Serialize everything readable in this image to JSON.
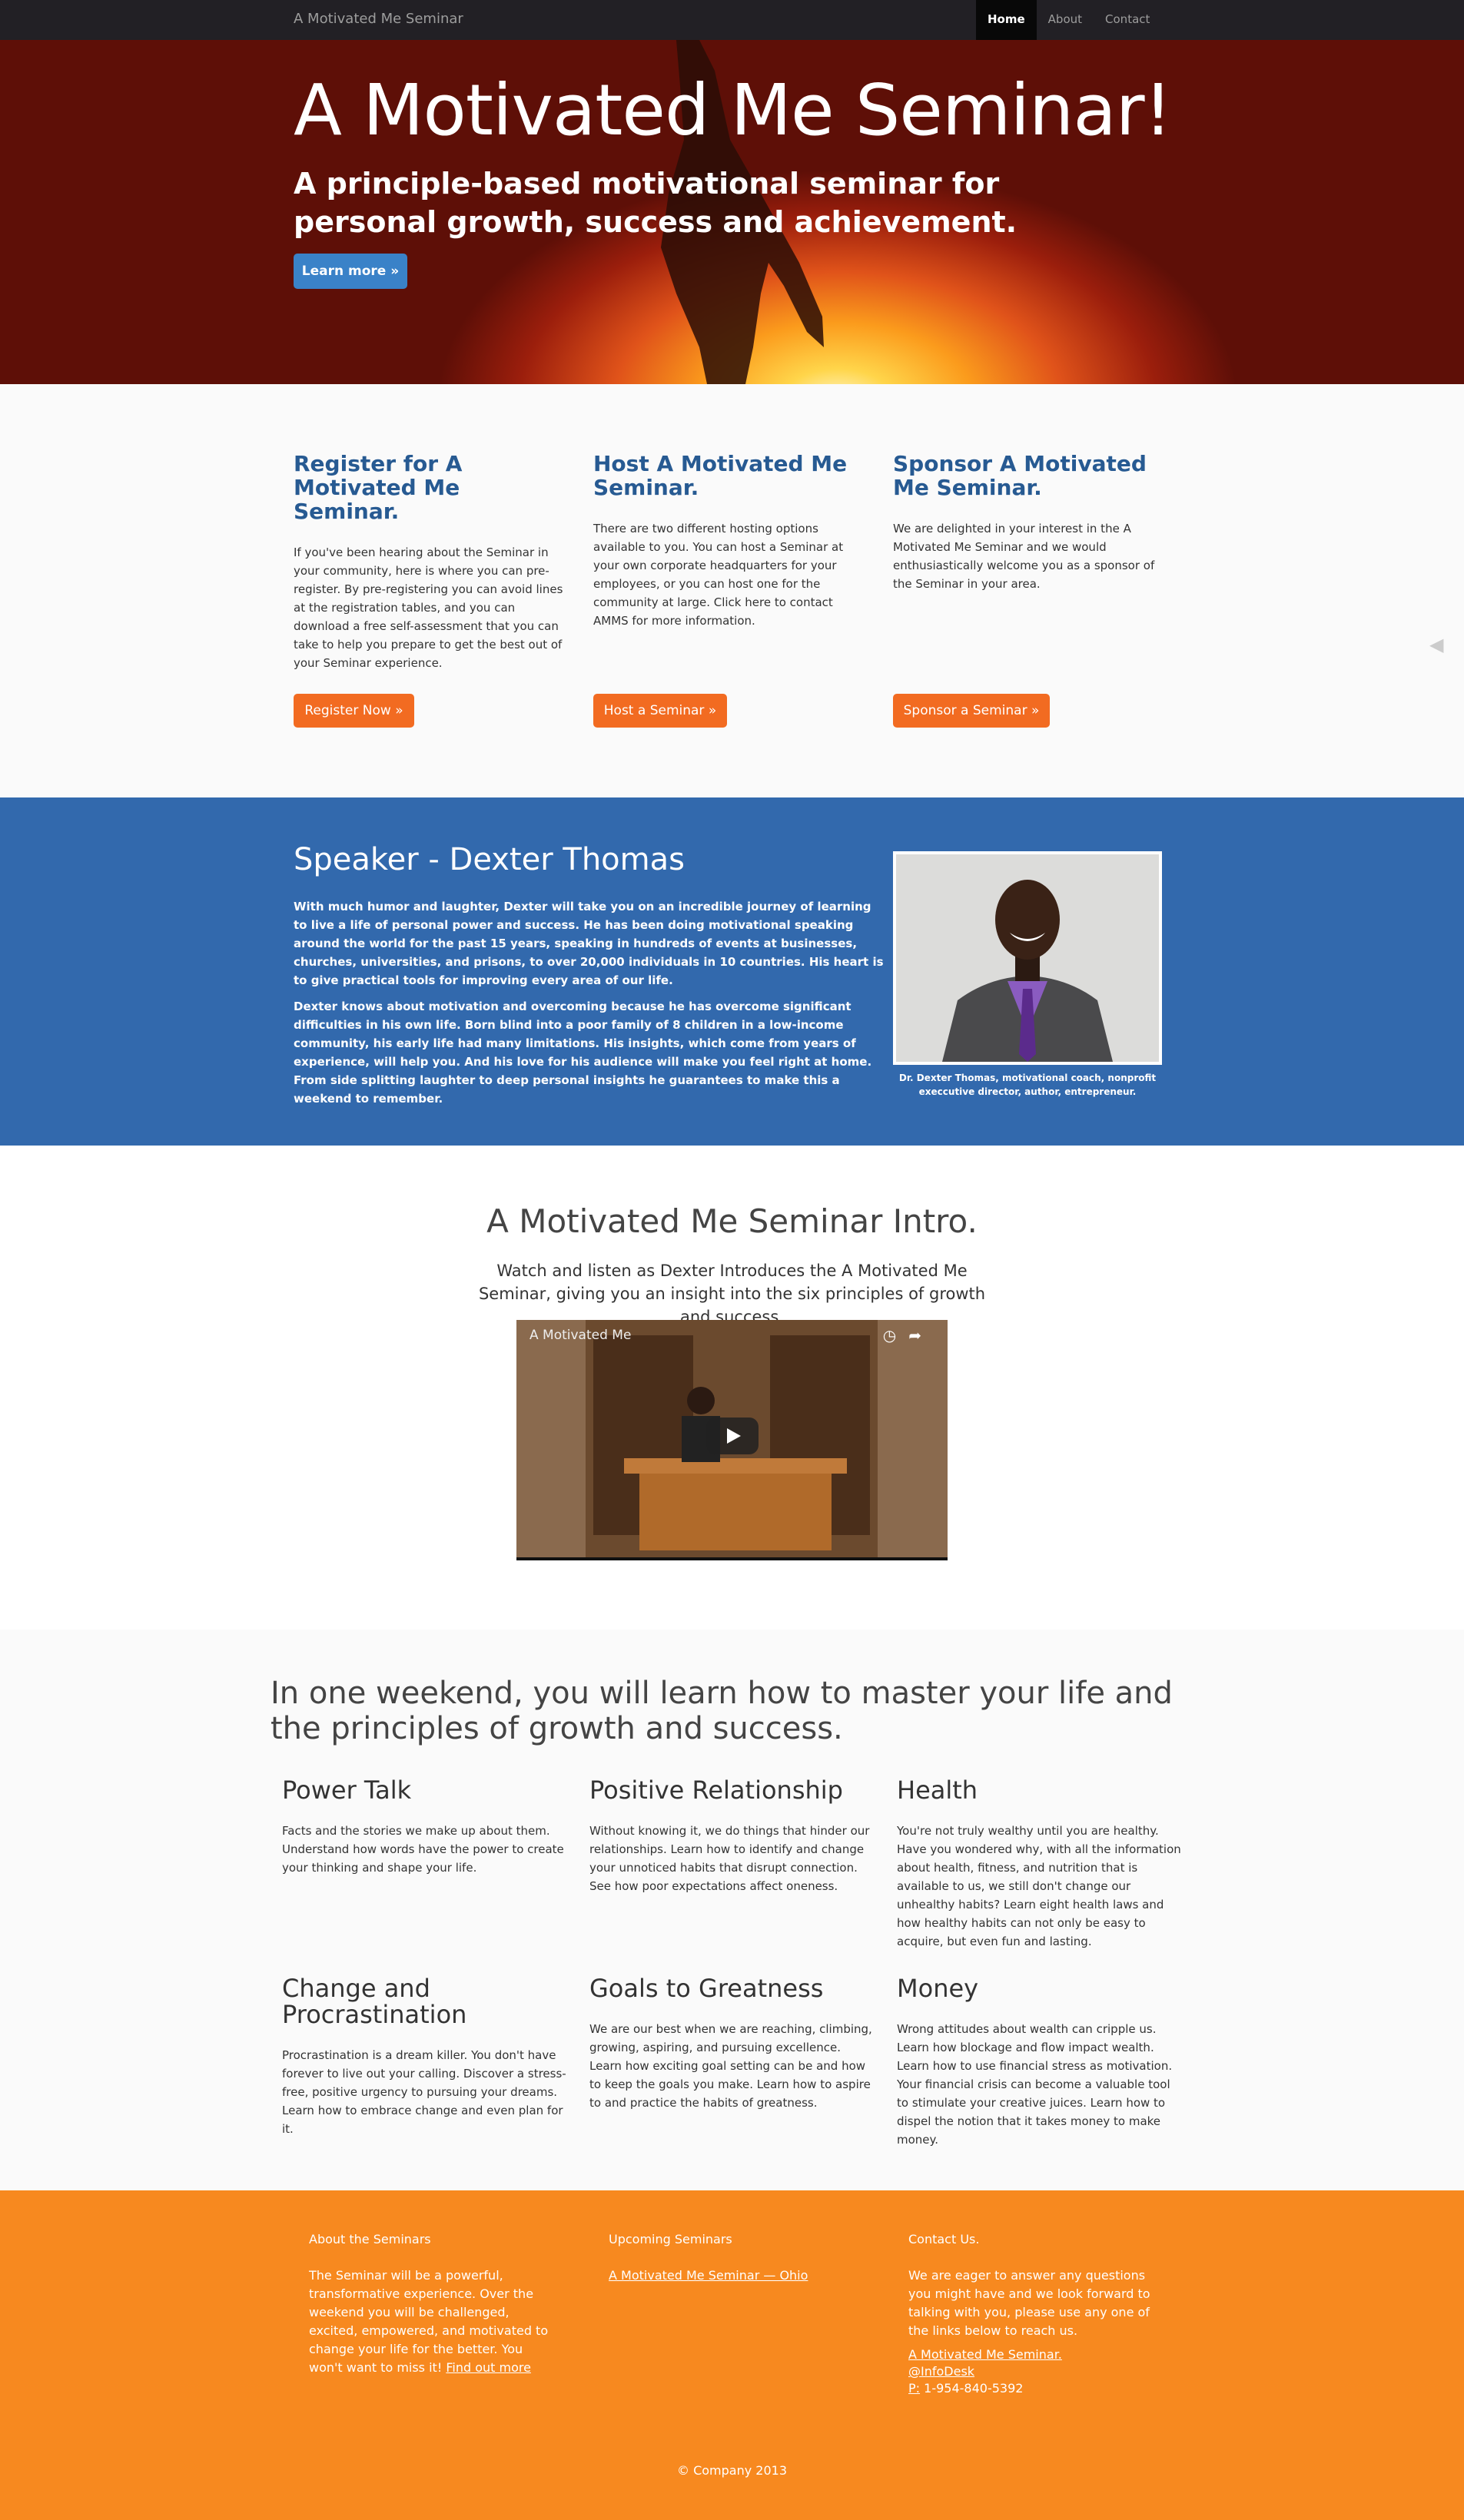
{
  "nav": {
    "brand": "A Motivated Me Seminar",
    "items": [
      {
        "label": "Home",
        "active": true
      },
      {
        "label": "About",
        "active": false
      },
      {
        "label": "Contact",
        "active": false
      }
    ]
  },
  "hero": {
    "title": "A Motivated Me Seminar!",
    "subtitle": "A principle-based motivational seminar for personal growth, success and achievement.",
    "button": "Learn more »"
  },
  "register": {
    "columns": [
      {
        "title": "Register for A Motivated Me Seminar.",
        "text": "If you've been hearing about the Seminar in your community, here is where you can pre-register. By pre-registering you can avoid lines at the registration tables, and you can download a free self-assessment that you can take to help you prepare to get the best out of your Seminar experience.",
        "button": "Register Now »"
      },
      {
        "title": "Host A Motivated Me Seminar.",
        "text": "There are two different hosting options available to you. You can host a Seminar at your own corporate headquarters for your employees, or you can host one for the community at large. Click here to contact AMMS for more information.",
        "button": "Host a Seminar »"
      },
      {
        "title": "Sponsor A Motivated Me Seminar.",
        "text": "We are delighted in your interest in the A Motivated Me Seminar and we would enthusiastically welcome you as a sponsor of the Seminar in your area.",
        "button": "Sponsor a Seminar »"
      }
    ]
  },
  "speaker": {
    "title": "Speaker - Dexter Thomas",
    "p1": "With much humor and laughter, Dexter will take you on an incredible journey of learning to live a life of personal power and success. He has been doing motivational speaking around the world for the past 15 years, speaking in hundreds of events at businesses, churches, universities, and prisons, to over 20,000 individuals in 10 countries. His heart is to give practical tools for improving every area of our life.",
    "p2": "Dexter knows about motivation and overcoming because he has overcome significant difficulties in his own life. Born blind into a poor family of 8 children in a low-income community, his early life had many limitations. His insights, which come from years of experience, will help you. And his love for his audience will make you feel right at home. From side splitting laughter to deep personal insights he guarantees to make this a weekend to remember.",
    "caption": "Dr. Dexter Thomas, motivational coach, nonprofit execcutive director, author, entrepreneur."
  },
  "intro": {
    "title": "A Motivated Me Seminar Intro.",
    "subtitle": "Watch and listen as Dexter Introduces the A Motivated Me Seminar, giving you an insight into the six principles of growth and success.",
    "video_title": "A Motivated Me"
  },
  "learn": {
    "heading": "In one weekend, you will learn how to master your life and the principles of growth and success.",
    "topics": [
      {
        "title": "Power Talk",
        "text": "Facts and the stories we make up about them. Understand how words have the power to create your thinking and shape your life."
      },
      {
        "title": "Positive Relationship",
        "text": "Without knowing it, we do things that hinder our relationships. Learn how to identify and change your unnoticed habits that disrupt connection. See how poor expectations affect oneness."
      },
      {
        "title": "Health",
        "text": "You're not truly wealthy until you are healthy. Have you wondered why, with all the information about health, fitness, and nutrition that is available to us, we still don't change our unhealthy habits? Learn eight health laws and how healthy habits can not only be easy to acquire, but even fun and lasting."
      },
      {
        "title": "Change and Procrastination",
        "text": "Procrastination is a dream killer. You don't have forever to live out your calling. Discover a stress-free, positive urgency to pursuing your dreams. Learn how to embrace change and even plan for it."
      },
      {
        "title": "Goals to Greatness",
        "text": "We are our best when we are reaching, climbing, growing, aspiring, and pursuing excellence. Learn how exciting goal setting can be and how to keep the goals you make. Learn how to aspire to and practice the habits of greatness."
      },
      {
        "title": "Money",
        "text": "Wrong attitudes about wealth can cripple us. Learn how blockage and flow impact wealth. Learn how to use financial stress as motivation. Your financial crisis can become a valuable tool to stimulate your creative juices. Learn how to dispel the notion that it takes money to make money."
      }
    ]
  },
  "footer": {
    "about_title": "About the Seminars",
    "about_text": "The Seminar will be a powerful, transformative experience. Over the weekend you will be challenged, excited, empowered, and motivated to change your life for the better. You won't want to miss it!",
    "about_link": "Find out more",
    "upcoming_title": "Upcoming Seminars",
    "upcoming_link": "A Motivated Me Seminar — Ohio",
    "contact_title": "Contact Us.",
    "contact_text": "We are eager to answer any questions you might have and we look forward to talking with you, please use any one of the links below to reach us.",
    "contact_name": "A Motivated Me Seminar.",
    "contact_handle": "@InfoDesk",
    "phone_label": "P:",
    "phone": "1-954-840-5392",
    "copyright": "© Company 2013"
  }
}
